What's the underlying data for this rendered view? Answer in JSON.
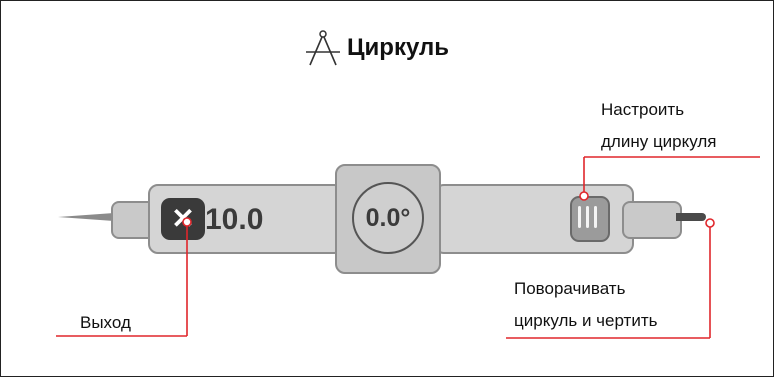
{
  "title": {
    "text": "Циркуль",
    "icon": "compass-icon"
  },
  "tool": {
    "length_value": "10.0",
    "angle_value": "0.0°",
    "exit_icon": "close-icon",
    "exit_glyph": "✕",
    "grip_icon": "grip-lines-icon"
  },
  "callouts": {
    "adjust_length_line1": "Настроить",
    "adjust_length_line2": "длину циркуля",
    "exit": "Выход",
    "rotate_line1": "Поворачивать",
    "rotate_line2": "циркуль и чертить"
  },
  "colors": {
    "callout_line": "#e0262b",
    "body_gray": "#d5d5d5",
    "dark_button": "#3a3a3a"
  }
}
